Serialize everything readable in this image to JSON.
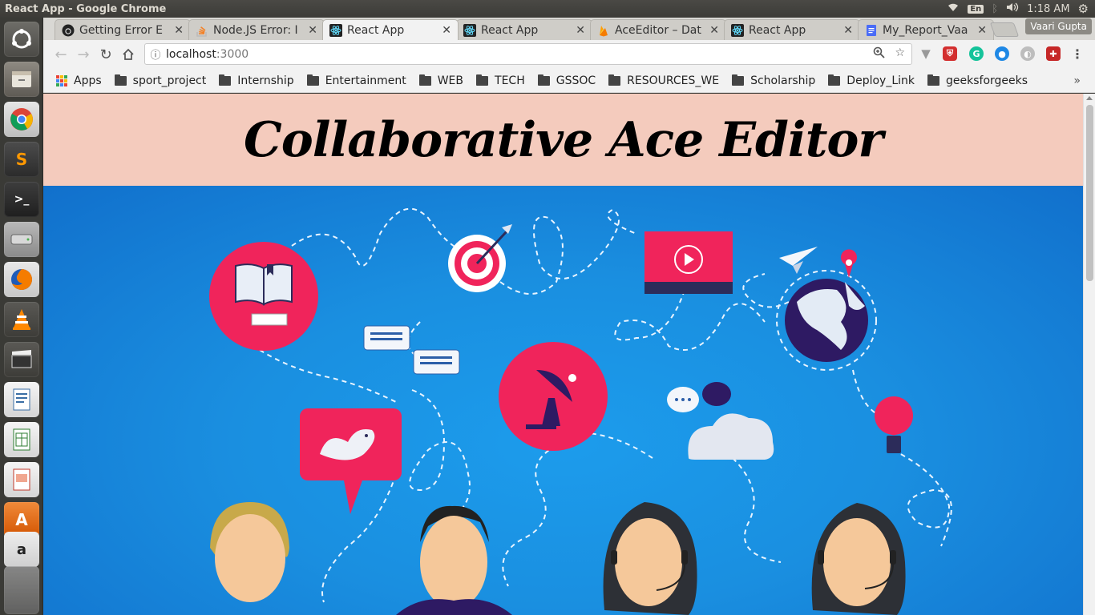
{
  "window": {
    "title": "React App - Google Chrome"
  },
  "system": {
    "keyboard": "En",
    "time": "1:18 AM"
  },
  "tabs": [
    {
      "label": "Getting Error E",
      "favicon": "github-icon"
    },
    {
      "label": "Node.JS Error: I",
      "favicon": "stackoverflow-icon"
    },
    {
      "label": "React App",
      "favicon": "react-icon",
      "active": true
    },
    {
      "label": "React App",
      "favicon": "react-icon"
    },
    {
      "label": "AceEditor – Dat",
      "favicon": "firebase-icon"
    },
    {
      "label": "React App",
      "favicon": "react-icon"
    },
    {
      "label": "My_Report_Vaa",
      "favicon": "docs-icon"
    }
  ],
  "profile": {
    "name": "Vaari Gupta"
  },
  "address": {
    "host": "localhost",
    "port": ":3000"
  },
  "bookmarks": [
    {
      "label": "Apps",
      "type": "apps"
    },
    {
      "label": "sport_project"
    },
    {
      "label": "Internship"
    },
    {
      "label": "Entertainment"
    },
    {
      "label": "WEB"
    },
    {
      "label": "TECH"
    },
    {
      "label": "GSSOC"
    },
    {
      "label": "RESOURCES_WE"
    },
    {
      "label": "Scholarship"
    },
    {
      "label": "Deploy_Link"
    },
    {
      "label": "geeksforgeeks"
    }
  ],
  "bookmarks_more": "»",
  "page": {
    "heading": "Collaborative Ace Editor",
    "header_bg": "#f4cbbd",
    "hero_bg": "#1a8fe0",
    "accent": "#f0245b"
  }
}
